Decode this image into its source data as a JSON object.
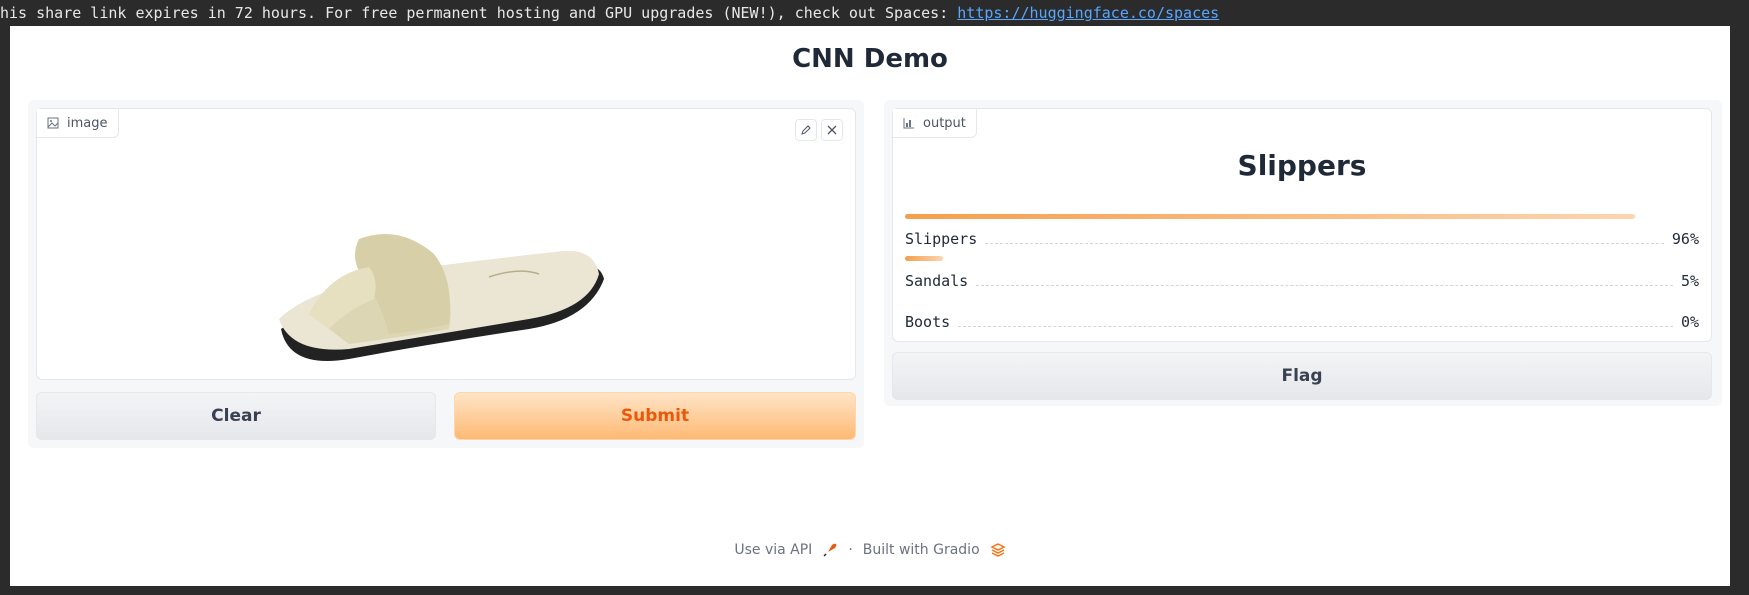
{
  "banner": {
    "text": "his share link expires in 72 hours. For free permanent hosting and GPU upgrades (NEW!), check out Spaces: ",
    "link": "https://huggingface.co/spaces"
  },
  "app": {
    "title": "CNN Demo"
  },
  "input": {
    "label": "image",
    "label_icon": "image-icon",
    "edit_icon": "pencil-icon",
    "close_icon": "close-icon",
    "image_description_icon": "slipper-image"
  },
  "buttons": {
    "clear": "Clear",
    "submit": "Submit",
    "flag": "Flag"
  },
  "output": {
    "label": "output",
    "label_icon": "bar-chart-icon",
    "top_label": "Slippers",
    "confidences": [
      {
        "label": "Slippers",
        "pct": "96%",
        "value": 0.96
      },
      {
        "label": "Sandals",
        "pct": "5%",
        "value": 0.05
      },
      {
        "label": "Boots",
        "pct": "0%",
        "value": 0.0
      }
    ]
  },
  "footer": {
    "api": "Use via API",
    "separator": "·",
    "built": "Built with Gradio",
    "api_icon": "rocket-icon",
    "gradio_icon": "gradio-logo-icon"
  },
  "colors": {
    "accent": "#f97316",
    "primary_text": "#ea580c"
  }
}
